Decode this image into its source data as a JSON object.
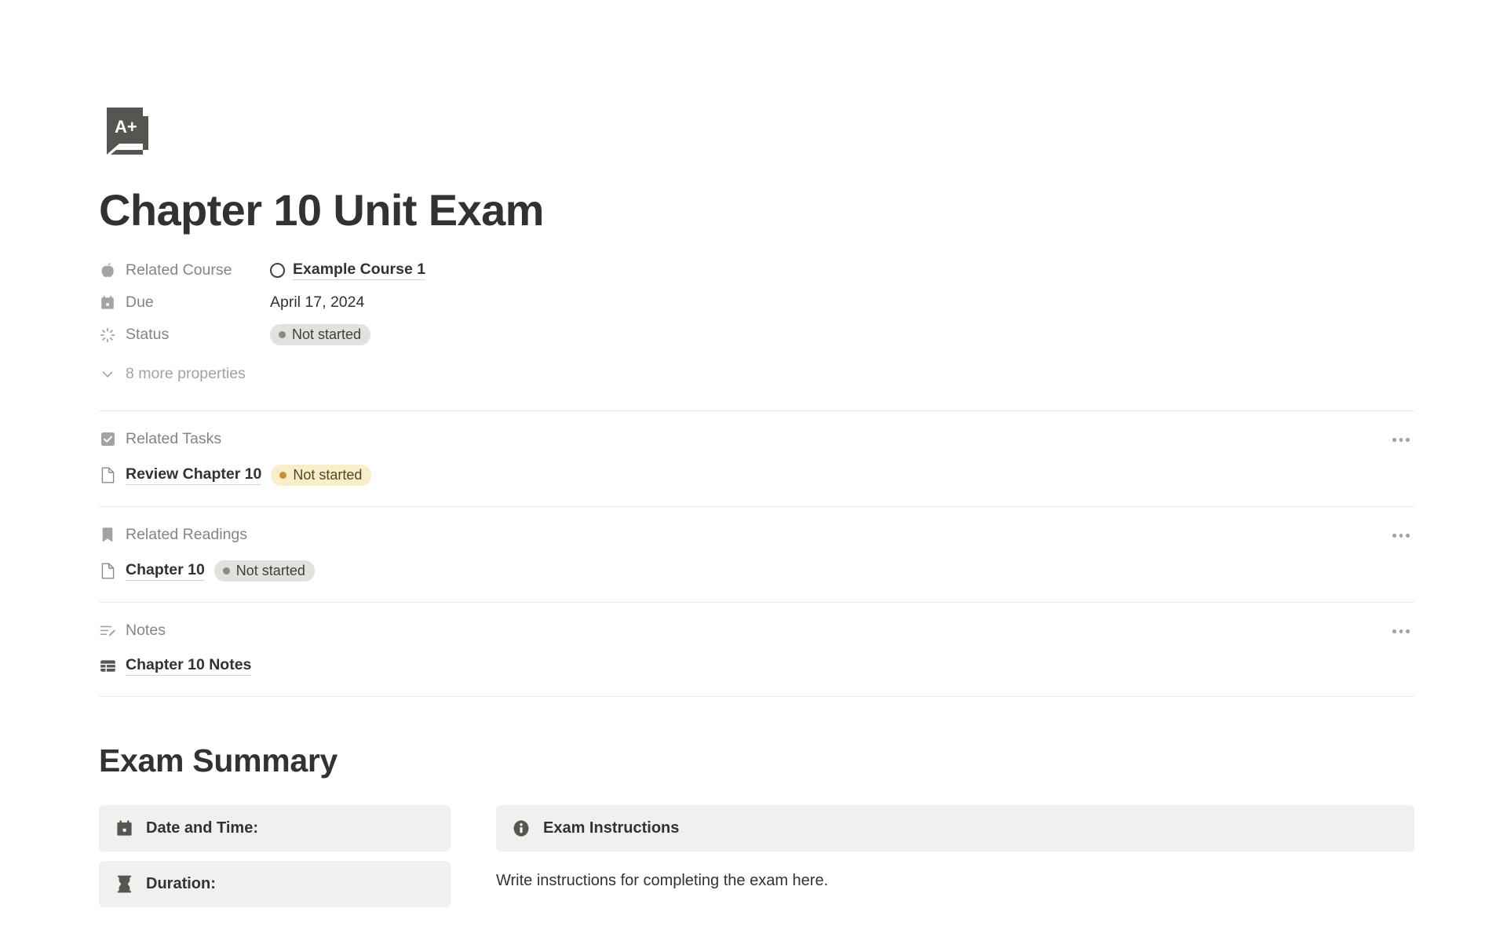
{
  "page": {
    "icon": "exam-a-plus-icon",
    "title": "Chapter 10 Unit Exam"
  },
  "properties": [
    {
      "icon": "apple-icon",
      "label": "Related Course",
      "type": "relation",
      "value": "Example Course 1"
    },
    {
      "icon": "calendar-icon",
      "label": "Due",
      "type": "date",
      "value": "April 17, 2024"
    },
    {
      "icon": "status-spinner-icon",
      "label": "Status",
      "type": "status",
      "value": "Not started",
      "badge_style": "gray"
    }
  ],
  "more_properties": {
    "icon": "chevron-down-icon",
    "label": "8 more properties"
  },
  "sections": [
    {
      "icon": "checkbox-checked-icon",
      "title": "Related Tasks",
      "menu": "section-options",
      "rows": [
        {
          "icon": "page-file-icon",
          "title": "Review Chapter 10",
          "badge": "Not started",
          "badge_style": "amber"
        }
      ]
    },
    {
      "icon": "bookmark-icon",
      "title": "Related Readings",
      "menu": "section-options",
      "rows": [
        {
          "icon": "page-file-icon",
          "title": "Chapter 10",
          "badge": "Not started",
          "badge_style": "gray"
        }
      ]
    },
    {
      "icon": "notes-edit-icon",
      "title": "Notes",
      "menu": "section-options",
      "rows": [
        {
          "icon": "table-grid-icon",
          "title": "Chapter 10 Notes",
          "badge": "",
          "badge_style": ""
        }
      ]
    }
  ],
  "summary": {
    "heading": "Exam Summary",
    "left_callouts": [
      {
        "icon": "calendar-icon",
        "label": "Date and Time:"
      },
      {
        "icon": "hourglass-icon",
        "label": "Duration:"
      }
    ],
    "right_callout": {
      "icon": "info-icon",
      "label": "Exam Instructions"
    },
    "right_body": "Write instructions for completing the exam here."
  },
  "colors": {
    "text": "#33322e",
    "muted": "#868481",
    "faint": "#a5a39f",
    "rule": "#eceae7",
    "callout_bg": "#f1f0ee",
    "badge_gray_bg": "#e2e1de",
    "badge_gray_dot": "#8c8a86",
    "badge_amber_bg": "#faeec8",
    "badge_amber_dot": "#cb912f",
    "icon_dark": "#56554f"
  }
}
